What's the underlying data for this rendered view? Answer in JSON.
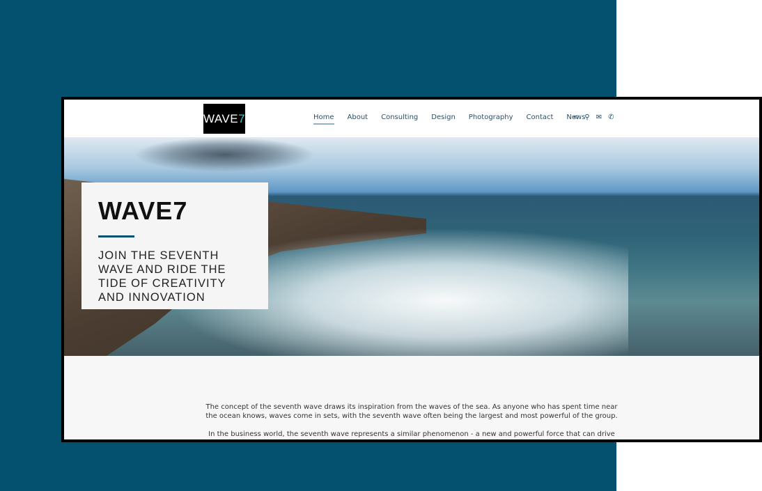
{
  "logo": {
    "text": "WAVE",
    "accent": "7"
  },
  "nav": {
    "items": [
      "Home",
      "About",
      "Consulting",
      "Design",
      "Photography",
      "Contact",
      "News"
    ],
    "active": "Home"
  },
  "icons": [
    "share-icon",
    "search-icon",
    "envelope-icon",
    "phone-icon"
  ],
  "hero": {
    "title": "WAVE7",
    "tagline": "JOIN THE SEVENTH WAVE AND RIDE THE TIDE OF CREATIVITY AND INNOVATION"
  },
  "content": {
    "paragraphs": [
      "The concept of the seventh wave draws its inspiration from the waves of the sea. As anyone who has spent time near the ocean knows, waves come in sets, with the seventh wave often being the largest and most powerful of the group.",
      "In the business world, the seventh wave represents a similar phenomenon - a new and powerful force that can drive"
    ]
  },
  "colors": {
    "brand": "#04506f",
    "accent": "#3cc6d0"
  }
}
